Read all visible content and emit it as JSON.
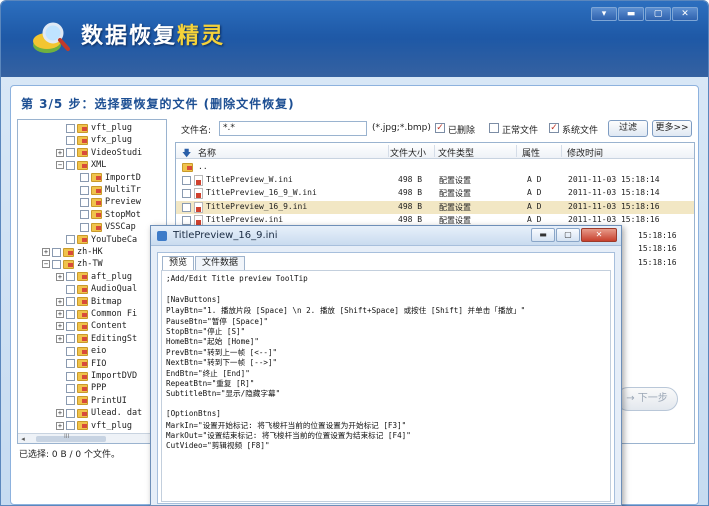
{
  "app": {
    "title_main": "数据恢复",
    "title_accent": "精灵"
  },
  "window_controls": {
    "menu": "▾",
    "minimize": "▬",
    "maximize": "▢",
    "close": "✕"
  },
  "step": {
    "title": "第 3/5 步：选择要恢复的文件 (删除文件恢复)"
  },
  "tree": {
    "scroll_left": "◂",
    "scroll_right": "▸",
    "scroll_grip": "III",
    "items": [
      {
        "label": "vft_plug",
        "level": 3,
        "expander": ""
      },
      {
        "label": "vfx_plug",
        "level": 3,
        "expander": ""
      },
      {
        "label": "VideoStudi",
        "level": 3,
        "expander": "+"
      },
      {
        "label": "XML",
        "level": 3,
        "expander": "−"
      },
      {
        "label": "ImportD",
        "level": 4,
        "expander": ""
      },
      {
        "label": "MultiTr",
        "level": 4,
        "expander": ""
      },
      {
        "label": "Preview",
        "level": 4,
        "expander": ""
      },
      {
        "label": "StopMot",
        "level": 4,
        "expander": ""
      },
      {
        "label": "VSSCap",
        "level": 4,
        "expander": ""
      },
      {
        "label": "YouTubeCa",
        "level": 3,
        "expander": ""
      },
      {
        "label": "zh-HK",
        "level": 2,
        "expander": "+"
      },
      {
        "label": "zh-TW",
        "level": 2,
        "expander": "−"
      },
      {
        "label": "aft_plug",
        "level": 3,
        "expander": "+"
      },
      {
        "label": "AudioQual",
        "level": 3,
        "expander": ""
      },
      {
        "label": "Bitmap",
        "level": 3,
        "expander": "+"
      },
      {
        "label": "Common Fi",
        "level": 3,
        "expander": "+"
      },
      {
        "label": "Content",
        "level": 3,
        "expander": "+"
      },
      {
        "label": "EditingSt",
        "level": 3,
        "expander": "+"
      },
      {
        "label": "eio",
        "level": 3,
        "expander": ""
      },
      {
        "label": "FIO",
        "level": 3,
        "expander": ""
      },
      {
        "label": "ImportDVD",
        "level": 3,
        "expander": ""
      },
      {
        "label": "PPP",
        "level": 3,
        "expander": ""
      },
      {
        "label": "PrintUI",
        "level": 3,
        "expander": ""
      },
      {
        "label": "Ulead. dat",
        "level": 3,
        "expander": "+"
      },
      {
        "label": "vft_plug",
        "level": 3,
        "expander": "+"
      }
    ]
  },
  "filter": {
    "filename_label": "文件名:",
    "filename_value": "*.*",
    "filename_hint": "(*.jpg;*.bmp)",
    "deleted_label": "已删除",
    "deleted_checked": true,
    "normal_label": "正常文件",
    "normal_checked": false,
    "system_label": "系统文件",
    "system_checked": true,
    "filter_button": "过滤",
    "more_button": "更多>>"
  },
  "filelist": {
    "headers": {
      "sort_arrow": "🡇",
      "name": "名称",
      "size": "文件大小",
      "type": "文件类型",
      "attr": "属性",
      "mtime": "修改时间"
    },
    "parent_row": "..",
    "rows": [
      {
        "name": "TitlePreview_W.ini",
        "size": "498 B",
        "type": "配置设置",
        "attr": "A D",
        "mtime": "2011-11-03 15:18:14"
      },
      {
        "name": "TitlePreview_16_9_W.ini",
        "size": "498 B",
        "type": "配置设置",
        "attr": "A D",
        "mtime": "2011-11-03 15:18:14"
      },
      {
        "name": "TitlePreview_16_9.ini",
        "size": "498 B",
        "type": "配置设置",
        "attr": "A D",
        "mtime": "2011-11-03 15:18:16"
      },
      {
        "name": "TitlePreview.ini",
        "size": "498 B",
        "type": "配置设置",
        "attr": "A D",
        "mtime": "2011-11-03 15:18:16"
      }
    ],
    "partial_times": [
      "15:18:16",
      "15:18:16",
      "15:18:16"
    ]
  },
  "status": {
    "selected": "已选择: 0 B / 0 个文件。"
  },
  "next_button": "下一步",
  "popup": {
    "title": "TitlePreview_16_9.ini",
    "controls": {
      "minimize": "▬",
      "maximize": "▢",
      "close": "✕"
    },
    "tabs": [
      "预览",
      "文件数据"
    ],
    "active_tab": 0,
    "lines": [
      ";Add/Edit Title preview ToolTip",
      "",
      "[NavButtons]",
      "PlayBtn=\"1. 播放片段 [Space] \\n 2. 播放 [Shift+Space] 或按住 [Shift] 并单击「播放」\"",
      "PauseBtn=\"暂停 [Space]\"",
      "StopBtn=\"停止 [S]\"",
      "HomeBtn=\"起始 [Home]\"",
      "PrevBtn=\"转到上一帧 [<--]\"",
      "NextBtn=\"转到下一帧 [-->]\"",
      "EndBtn=\"终止 [End]\"",
      "RepeatBtn=\"重复 [R]\"",
      "SubtitleBtn=\"显示/隐藏字幕\"",
      "",
      "[OptionBtns]",
      "MarkIn=\"设置开始标记: 将飞梭杆当前的位置设置为开始标记 [F3]\"",
      "MarkOut=\"设置结束标记: 将飞梭杆当前的位置设置为结束标记 [F4]\"",
      "CutVideo=\"剪辑视频 [F8]\""
    ]
  },
  "colors": {
    "banner": "#1f5aa8",
    "accent_title": "#f5d23a",
    "step_title": "#1d4f93",
    "selected_row": "#f2e7c4"
  }
}
